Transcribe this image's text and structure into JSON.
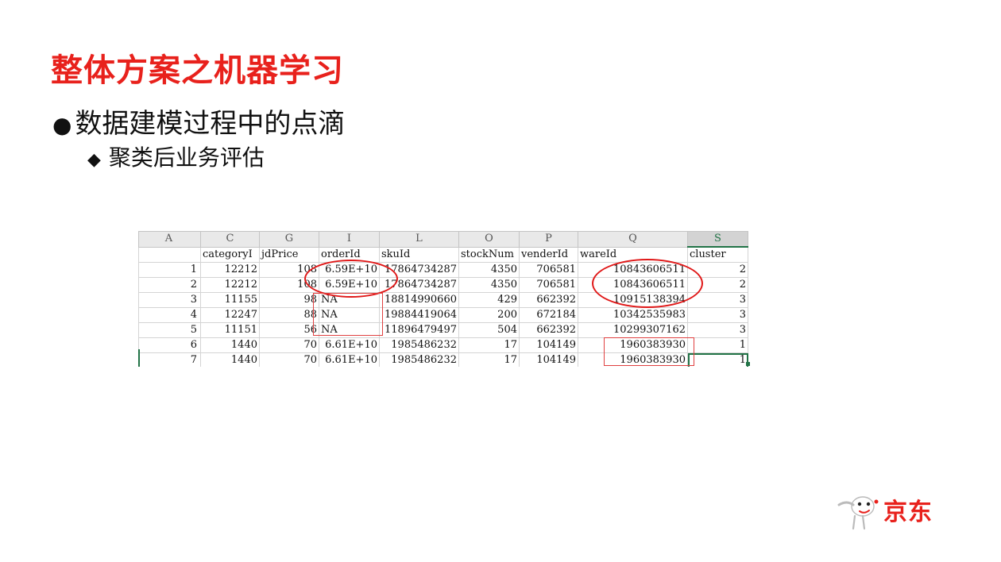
{
  "slide": {
    "title": "整体方案之机器学习",
    "bullet1": "数据建模过程中的点滴",
    "bullet1_marker": "●",
    "bullet2": "聚类后业务评估",
    "bullet2_marker": "◆"
  },
  "spreadsheet": {
    "column_letters": [
      "A",
      "C",
      "G",
      "I",
      "L",
      "O",
      "P",
      "Q",
      "S"
    ],
    "selected_column": "S",
    "headers": [
      "",
      "categoryI",
      "jdPrice",
      "orderId",
      "skuId",
      "stockNum",
      "venderId",
      "wareId",
      "cluster"
    ],
    "rows": [
      [
        "1",
        "12212",
        "108",
        "6.59E+10",
        "17864734287",
        "4350",
        "706581",
        "10843606511",
        "2"
      ],
      [
        "2",
        "12212",
        "108",
        "6.59E+10",
        "17864734287",
        "4350",
        "706581",
        "10843606511",
        "2"
      ],
      [
        "3",
        "11155",
        "98",
        "NA",
        "18814990660",
        "429",
        "662392",
        "10915138394",
        "3"
      ],
      [
        "4",
        "12247",
        "88",
        "NA",
        "19884419064",
        "200",
        "672184",
        "10342535983",
        "3"
      ],
      [
        "5",
        "11151",
        "56",
        "NA",
        "11896479497",
        "504",
        "662392",
        "10299307162",
        "3"
      ],
      [
        "6",
        "1440",
        "70",
        "6.61E+10",
        "1985486232",
        "17",
        "104149",
        "1960383930",
        "1"
      ],
      [
        "7",
        "1440",
        "70",
        "6.61E+10",
        "1985486232",
        "17",
        "104149",
        "1960383930",
        "1"
      ]
    ],
    "annotation_color": "#e01818",
    "selection_color": "#217346"
  },
  "logo": {
    "brand_text": "京东",
    "icon": "jd-dog-mascot-icon",
    "color": "#e8211c"
  }
}
